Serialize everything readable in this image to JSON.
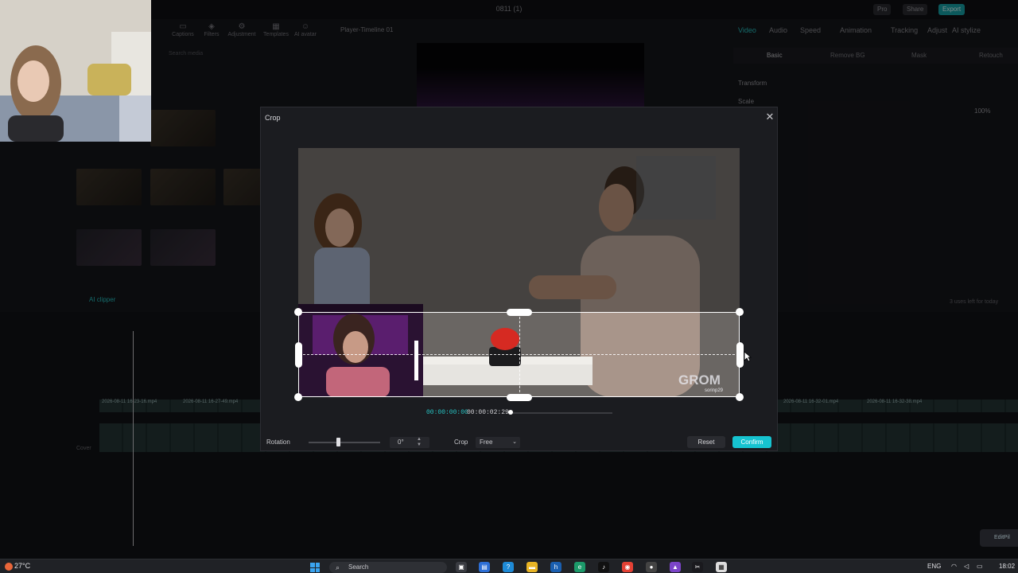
{
  "window": {
    "title": "0811 (1)",
    "pro_label": "Pro",
    "share_label": "Share",
    "export_label": "Export"
  },
  "media_toolbar": {
    "items": [
      "Captions",
      "Filters",
      "Adjustment",
      "Templates",
      "AI avatar"
    ],
    "search_placeholder": "Search media"
  },
  "player": {
    "title": "Player-Timeline 01"
  },
  "properties": {
    "tabs": [
      "Video",
      "Audio",
      "Speed",
      "Animation",
      "Tracking",
      "Adjust",
      "AI stylize"
    ],
    "active_tab": "Video",
    "subtabs": [
      "Basic",
      "Remove BG",
      "Mask",
      "Retouch"
    ],
    "transform_label": "Transform",
    "scale_label": "Scale",
    "scale_value": "100%",
    "quality_note": "3 uses left for today"
  },
  "timeline": {
    "cover_label": "Cover",
    "ai_clipper_label": "AI clipper",
    "clip_names": [
      "2026-08-11 16-23-16.mp4",
      "2026-08-11 16-27-49.mp4",
      "2026-08-11 16-32-01.mp4",
      "2026-08-11 16-32-38.mp4"
    ]
  },
  "crop_dialog": {
    "title": "Crop",
    "close_icon": "close-icon",
    "current_time": "00:00:00:00",
    "total_time": "00:00:02:29",
    "seek_fraction": 0.0,
    "rotation_label": "Rotation",
    "rotation_value": "0°",
    "crop_label": "Crop",
    "crop_ratio": "Free",
    "reset_label": "Reset",
    "confirm_label": "Confirm",
    "video_overlay_text": "GROM",
    "video_overlay_sub": "sorinp29"
  },
  "taskbar": {
    "weather": "27°C",
    "search_label": "Search",
    "language": "ENG",
    "time": "18:02"
  },
  "floating": {
    "editpilot_label": "EditPil"
  },
  "colors": {
    "accent": "#16c3d0",
    "teal_text": "#27c2c2",
    "dialog_bg": "#1b1c20"
  }
}
